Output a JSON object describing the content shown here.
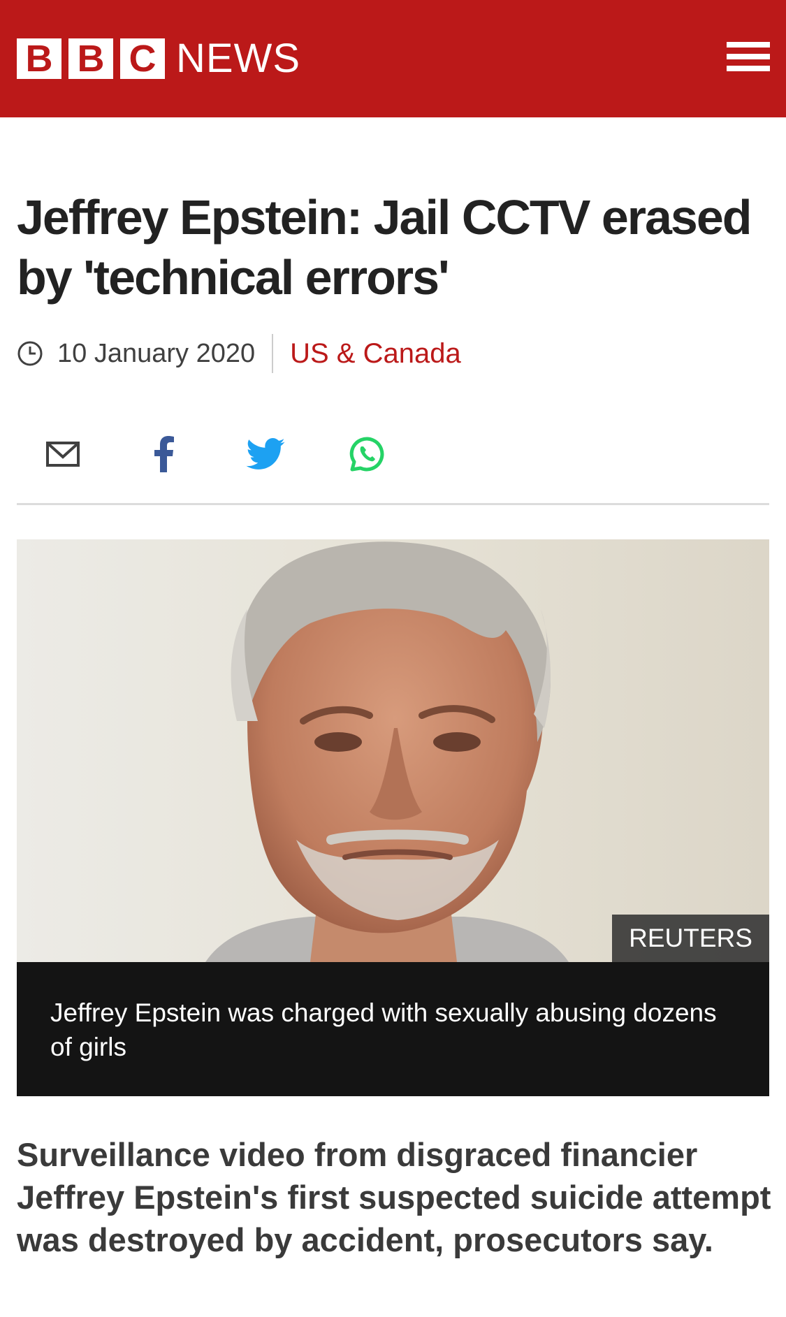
{
  "header": {
    "logo_letters": [
      "B",
      "B",
      "C"
    ],
    "logo_word": "NEWS",
    "brand_color": "#bb1919",
    "menu_icon": "hamburger-menu-icon"
  },
  "article": {
    "headline": "Jeffrey Epstein: Jail CCTV erased by 'technical errors'",
    "date": "10 January 2020",
    "section": "US & Canada",
    "share": [
      {
        "icon": "email-icon"
      },
      {
        "icon": "facebook-icon",
        "color": "#3b5998"
      },
      {
        "icon": "twitter-icon",
        "color": "#1da1f2"
      },
      {
        "icon": "whatsapp-icon",
        "color": "#25d366"
      }
    ],
    "image": {
      "credit": "REUTERS",
      "caption": "Jeffrey Epstein was charged with sexually abusing dozens of girls"
    },
    "intro": "Surveillance video from disgraced financier Jeffrey Epstein's first suspected suicide attempt was destroyed by accident, prosecutors say."
  }
}
